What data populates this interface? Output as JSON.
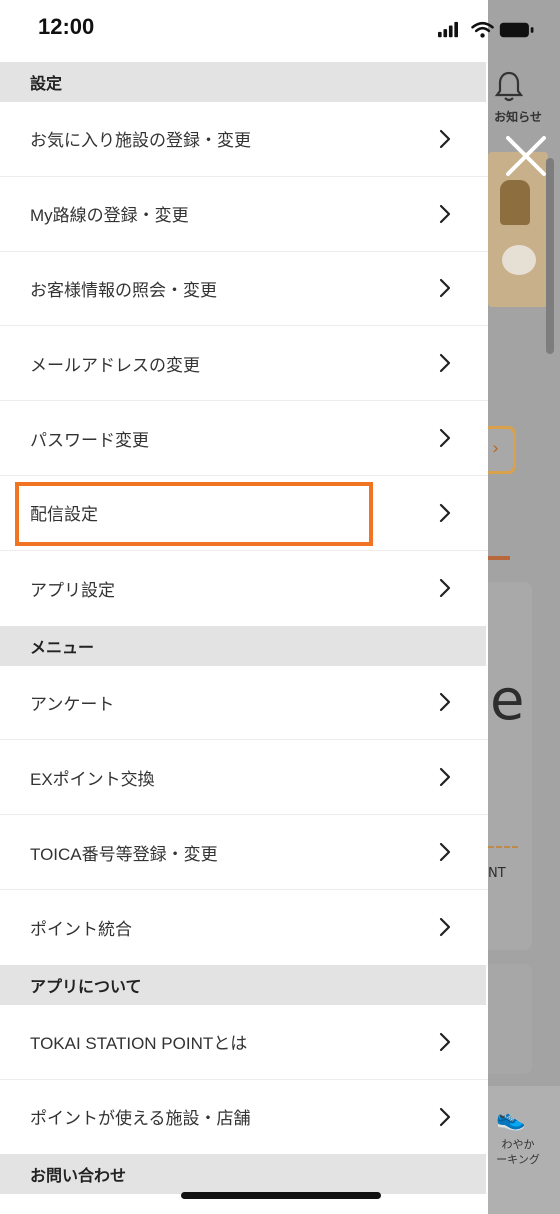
{
  "status_bar": {
    "time": "12:00"
  },
  "background": {
    "notifications_label": "お知らせ",
    "walking_label": "わやか\nーキング",
    "partial_letter": "e",
    "partial_text": "NT"
  },
  "drawer": {
    "sections": [
      {
        "title": "設定",
        "items": [
          {
            "label": "お気に入り施設の登録・変更"
          },
          {
            "label": "My路線の登録・変更"
          },
          {
            "label": "お客様情報の照会・変更"
          },
          {
            "label": "メールアドレスの変更"
          },
          {
            "label": "パスワード変更"
          },
          {
            "label": "配信設定",
            "highlighted": true
          },
          {
            "label": "アプリ設定"
          }
        ]
      },
      {
        "title": "メニュー",
        "items": [
          {
            "label": "アンケート"
          },
          {
            "label": "EXポイント交換"
          },
          {
            "label": "TOICA番号等登録・変更"
          },
          {
            "label": "ポイント統合"
          }
        ]
      },
      {
        "title": "アプリについて",
        "items": [
          {
            "label": "TOKAI STATION POINTとは"
          },
          {
            "label": "ポイントが使える施設・店舗"
          }
        ]
      },
      {
        "title": "お問い合わせ",
        "items": []
      }
    ]
  },
  "colors": {
    "highlight": "#f07422",
    "section_bg": "#e3e3e3",
    "text": "#333333"
  }
}
